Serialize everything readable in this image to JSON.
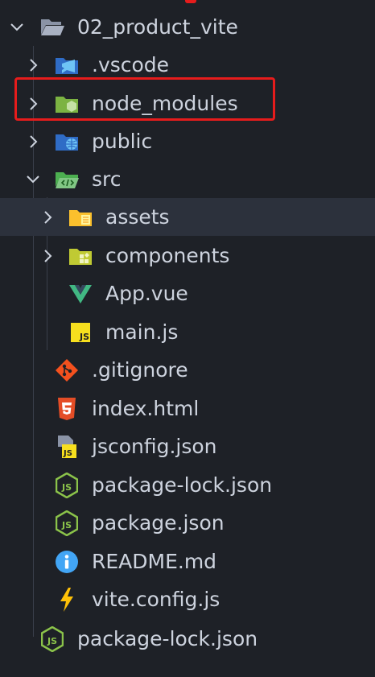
{
  "explorer": {
    "root": {
      "label": "02_product_vite",
      "icon": "folder-open-icon"
    },
    "items": [
      {
        "label": ".vscode",
        "icon": "vscode-folder-icon",
        "kind": "folder",
        "expanded": false
      },
      {
        "label": "node_modules",
        "icon": "node-folder-icon",
        "kind": "folder",
        "expanded": false
      },
      {
        "label": "public",
        "icon": "public-folder-icon",
        "kind": "folder",
        "expanded": false
      },
      {
        "label": "src",
        "icon": "src-folder-icon",
        "kind": "folder",
        "expanded": true
      },
      {
        "label": "assets",
        "icon": "assets-folder-icon",
        "kind": "folder",
        "expanded": false
      },
      {
        "label": "components",
        "icon": "components-folder-icon",
        "kind": "folder",
        "expanded": false
      },
      {
        "label": "App.vue",
        "icon": "vue-file-icon",
        "kind": "file"
      },
      {
        "label": "main.js",
        "icon": "js-file-icon",
        "kind": "file"
      },
      {
        "label": ".gitignore",
        "icon": "git-file-icon",
        "kind": "file"
      },
      {
        "label": "index.html",
        "icon": "html-file-icon",
        "kind": "file"
      },
      {
        "label": "jsconfig.json",
        "icon": "jsconfig-file-icon",
        "kind": "file"
      },
      {
        "label": "package-lock.json",
        "icon": "node-json-file-icon",
        "kind": "file"
      },
      {
        "label": "package.json",
        "icon": "node-json-file-icon",
        "kind": "file"
      },
      {
        "label": "README.md",
        "icon": "info-file-icon",
        "kind": "file"
      },
      {
        "label": "vite.config.js",
        "icon": "vite-file-icon",
        "kind": "file"
      },
      {
        "label": "package-lock.json",
        "icon": "node-json-file-icon",
        "kind": "file"
      }
    ]
  },
  "colors": {
    "background": "#1e2127",
    "text": "#cdd3de",
    "selected_row": "#2c313c",
    "highlight": "#e61c1c"
  }
}
